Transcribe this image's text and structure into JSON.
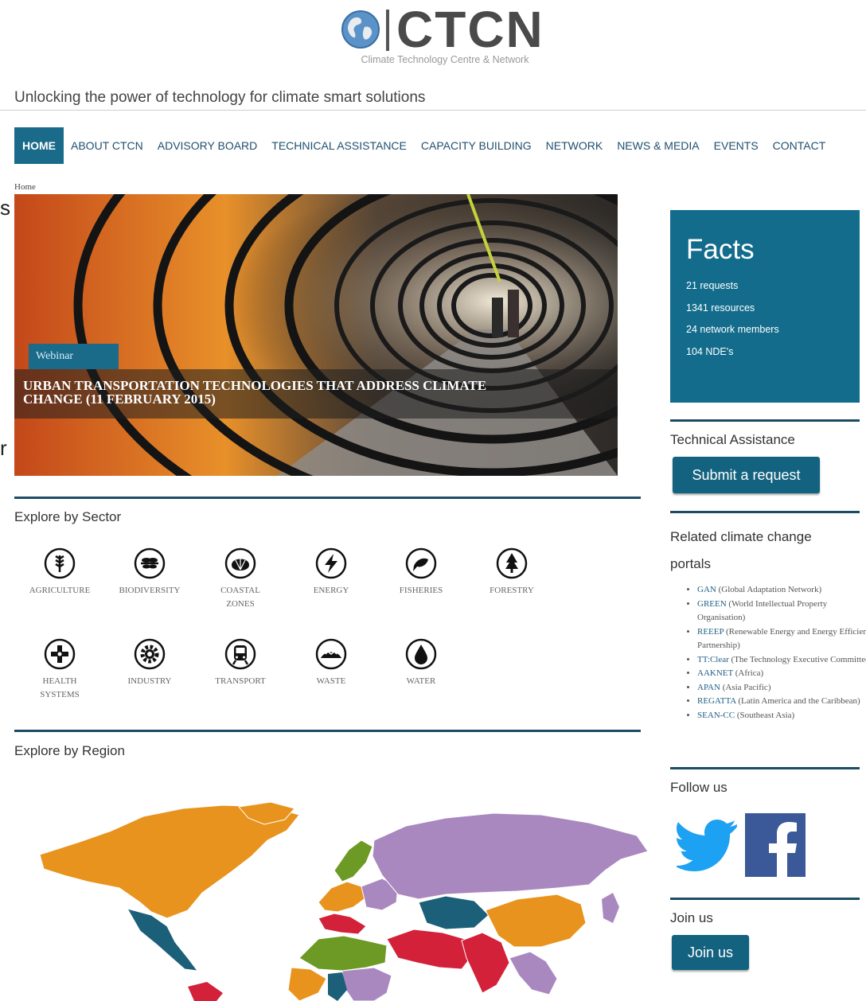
{
  "logo": {
    "text": "CTCN",
    "subtitle": "Climate Technology Centre & Network"
  },
  "tagline": "Unlocking the power of technology for climate smart solutions",
  "nav": {
    "items": [
      {
        "label": "HOME",
        "active": true
      },
      {
        "label": "ABOUT CTCN"
      },
      {
        "label": "ADVISORY BOARD"
      },
      {
        "label": "TECHNICAL ASSISTANCE"
      },
      {
        "label": "CAPACITY BUILDING"
      },
      {
        "label": "NETWORK"
      },
      {
        "label": "NEWS & MEDIA"
      },
      {
        "label": "EVENTS"
      },
      {
        "label": "CONTACT"
      }
    ]
  },
  "breadcrumb": "Home",
  "hero": {
    "badge": "Webinar",
    "title": "Urban transportation technologies that address climate change (11 February 2015)"
  },
  "sectors": {
    "heading": "Explore by Sector",
    "items": [
      {
        "line1": "AGRICULTURE",
        "line2": "",
        "icon": "wheat-icon"
      },
      {
        "line1": "BIODIVERSITY",
        "line2": "",
        "icon": "dragonfly-icon"
      },
      {
        "line1": "COASTAL",
        "line2": "ZONES",
        "icon": "shell-icon"
      },
      {
        "line1": "ENERGY",
        "line2": "",
        "icon": "lightning-icon"
      },
      {
        "line1": "FISHERIES",
        "line2": "",
        "icon": "fish-icon"
      },
      {
        "line1": "FORESTRY",
        "line2": "",
        "icon": "tree-icon"
      },
      {
        "line1": "HEALTH",
        "line2": "SYSTEMS",
        "icon": "medical-icon"
      },
      {
        "line1": "INDUSTRY",
        "line2": "",
        "icon": "gear-icon"
      },
      {
        "line1": "TRANSPORT",
        "line2": "",
        "icon": "train-icon"
      },
      {
        "line1": "WASTE",
        "line2": "",
        "icon": "landfill-icon"
      },
      {
        "line1": "WATER",
        "line2": "",
        "icon": "water-drop-icon"
      }
    ]
  },
  "regions": {
    "heading": "Explore by Region"
  },
  "facts": {
    "title": "Facts",
    "items": [
      "21 requests",
      "1341 resources",
      "24 network members",
      "104 NDE's"
    ]
  },
  "technical_assistance": {
    "heading": "Technical Assistance",
    "button": "Submit a request"
  },
  "portals": {
    "heading_line1": "Related climate change",
    "heading_line2": "portals",
    "items": [
      {
        "link": "GAN",
        "text": " (Global Adaptation Network)"
      },
      {
        "link": "GREEN",
        "text": " (World Intellectual Property Organisation)"
      },
      {
        "link": "REEEP",
        "text": " (Renewable Energy and Energy Efficiency Partnership)"
      },
      {
        "link": "TT:Clear",
        "text": " (The Technology Executive Committee's)"
      },
      {
        "link": "AAKNET",
        "text": " (Africa)"
      },
      {
        "link": "APAN",
        "text": " (Asia Pacific)"
      },
      {
        "link": "REGATTA",
        "text": " (Latin America and the Caribbean)"
      },
      {
        "link": "SEAN-CC",
        "text": " (Southeast Asia)"
      }
    ]
  },
  "follow": {
    "heading": "Follow us",
    "icons": [
      "twitter-icon",
      "facebook-icon"
    ]
  },
  "join": {
    "heading": "Join us",
    "button": "Join us"
  },
  "colors": {
    "brand_blue": "#136c8c",
    "region_americas": "#e8931d",
    "region_europe": "#6d9a24",
    "region_asia": "#a988c0",
    "region_central_asia": "#1b5f78",
    "region_middle_east": "#d3213a"
  }
}
